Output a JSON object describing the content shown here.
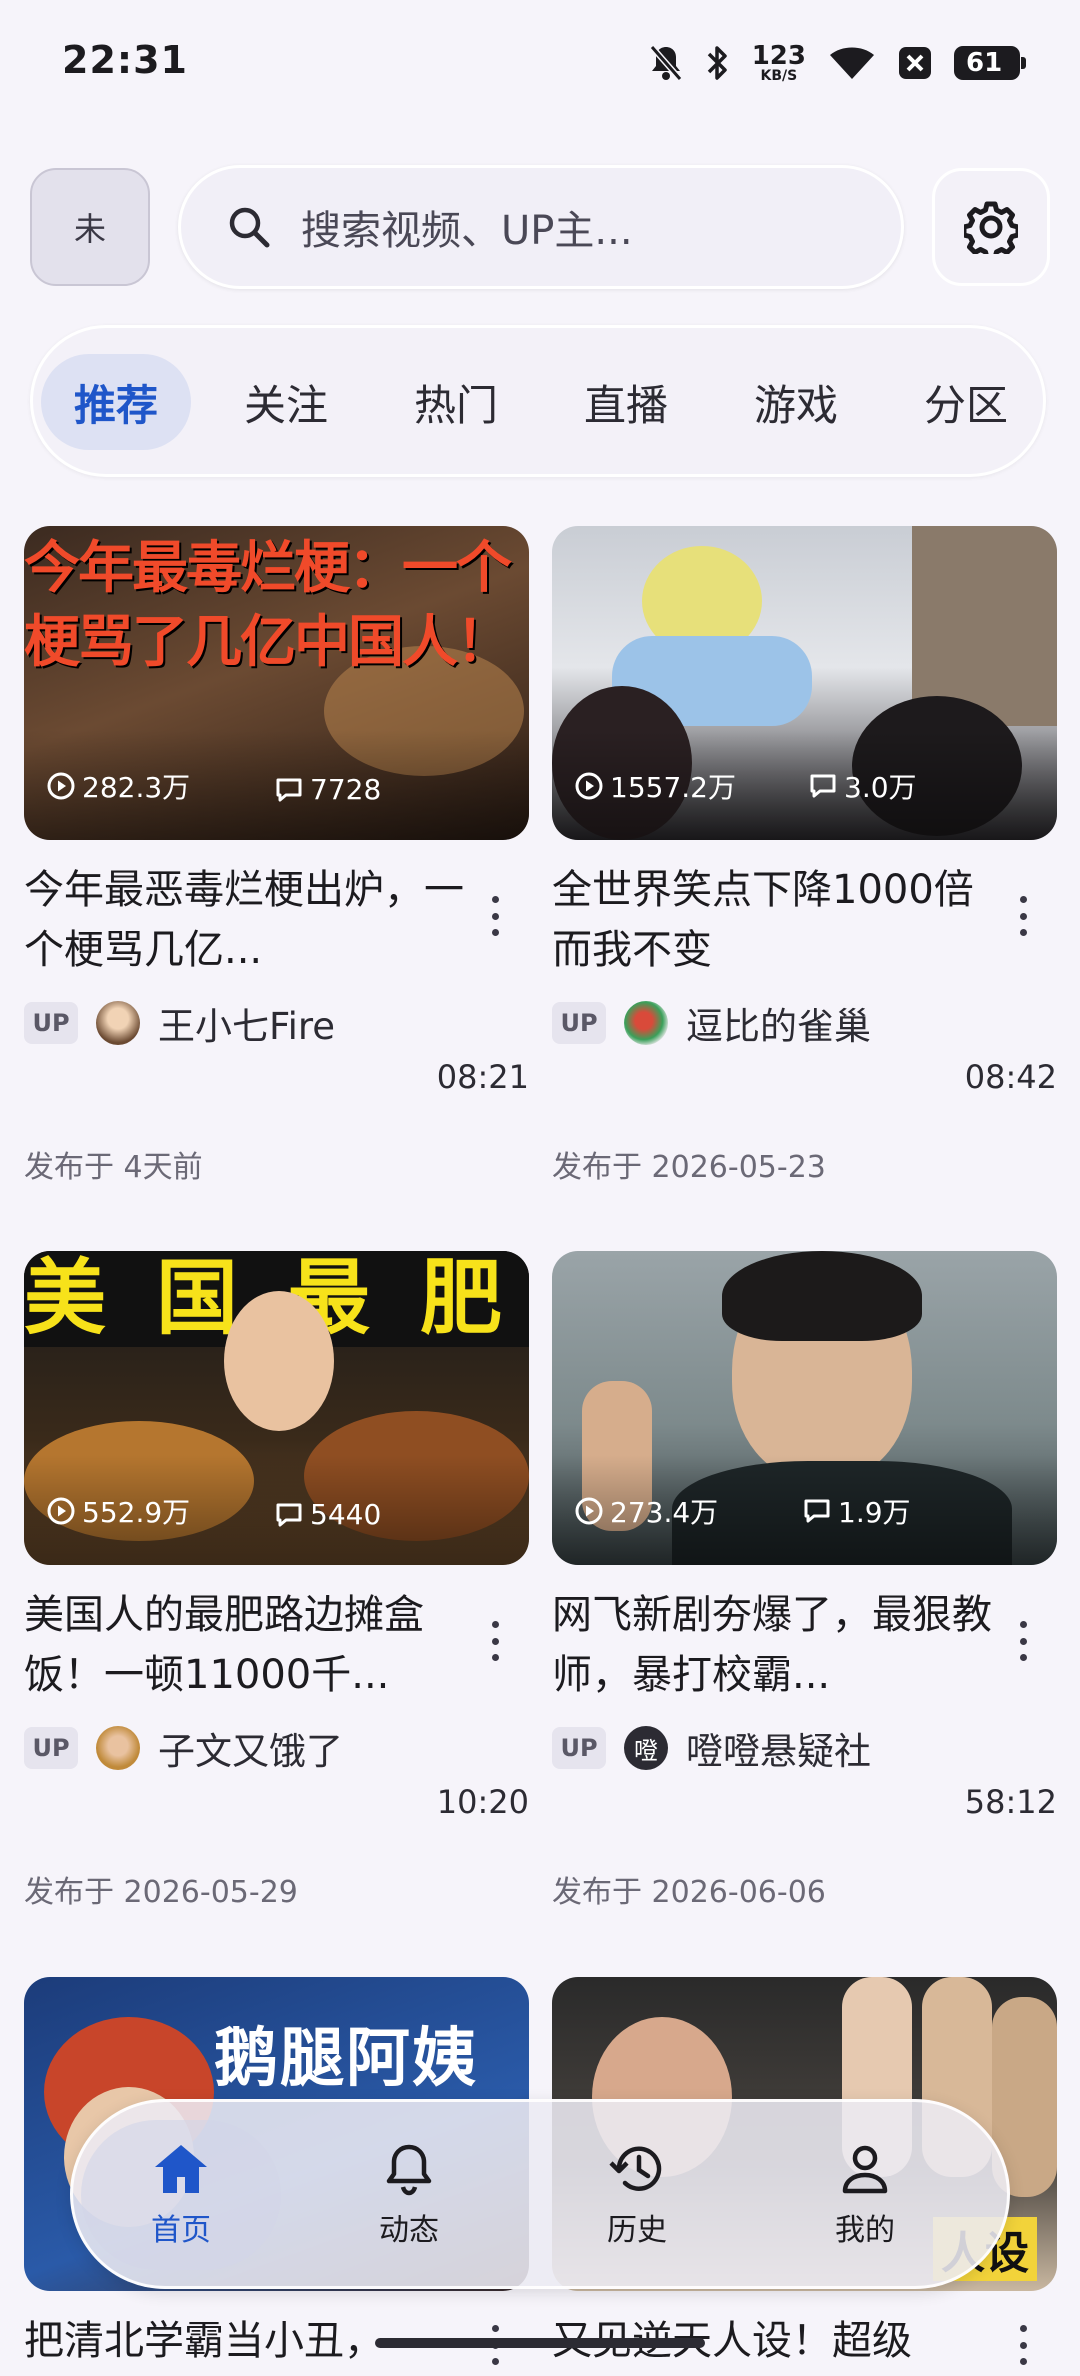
{
  "status_bar": {
    "time": "22:31",
    "net_speed": "123",
    "net_unit": "KB/S",
    "battery": "61"
  },
  "header": {
    "avatar_text": "未",
    "search_placeholder": "搜索视频、UP主..."
  },
  "tabs": [
    "推荐",
    "关注",
    "热门",
    "直播",
    "游戏",
    "分区"
  ],
  "videos": [
    {
      "thumb_caption": "今年最毒烂梗：一个梗骂了几亿中国人！",
      "views": "282.3万",
      "comments": "7728",
      "title": "今年最恶毒烂梗出炉，一个梗骂几亿...",
      "up_badge": "UP",
      "up_name": "王小七Fire",
      "duration": "08:21",
      "date": "发布于 4天前"
    },
    {
      "views": "1557.2万",
      "comments": "3.0万",
      "title": "全世界笑点下降1000倍而我不变",
      "up_badge": "UP",
      "up_name": "逗比的雀巢",
      "duration": "08:42",
      "date": "发布于 2026-05-23"
    },
    {
      "thumb_caption": "美国最肥",
      "views": "552.9万",
      "comments": "5440",
      "title": "美国人的最肥路边摊盒饭！一顿11000千...",
      "up_badge": "UP",
      "up_name": "子文又饿了",
      "duration": "10:20",
      "date": "发布于 2026-05-29"
    },
    {
      "views": "273.4万",
      "comments": "1.9万",
      "title": "网飞新剧夯爆了，最狠教师，暴打校霸...",
      "up_badge": "UP",
      "up_name": "噔噔悬疑社",
      "up_avatar_text": "噔",
      "duration": "58:12",
      "date": "发布于 2026-06-06"
    },
    {
      "thumb_caption": "鹅腿阿姨",
      "title": "把清北学霸当小丑，"
    },
    {
      "thumb_caption": "人设",
      "title": "又见逆天人设！超级"
    }
  ],
  "bottom_nav": [
    "首页",
    "动态",
    "历史",
    "我的"
  ],
  "colors": {
    "accent": "#1F56C9",
    "background": "#F6F4FA"
  }
}
